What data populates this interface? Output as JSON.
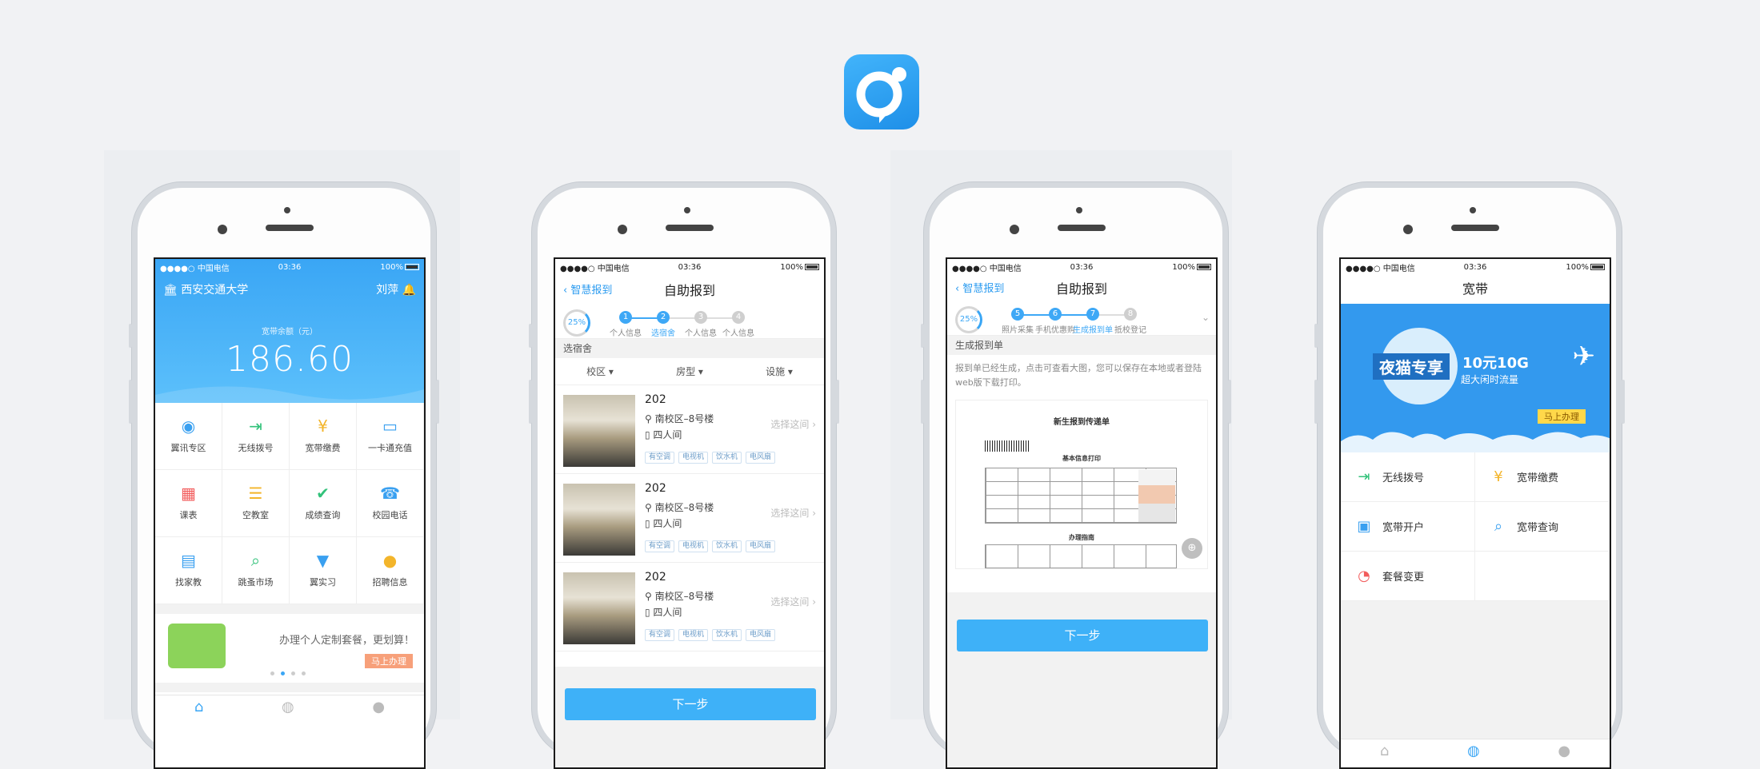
{
  "colors": {
    "accent": "#3ea8f6",
    "button": "#3eb1f8",
    "banner": "#3399ee",
    "orange": "#f7a07a",
    "yellow": "#ffd84a"
  },
  "statusbar": {
    "carrier": "●●●●○ 中国电信",
    "time": "03:36",
    "battery": "100%"
  },
  "screen1": {
    "school": "西安交通大学",
    "user": "刘萍",
    "balance_label": "宽带余额（元）",
    "balance": "186.60",
    "grid": [
      {
        "label": "翼讯专区",
        "icon": "swirl-icon",
        "color": "#3aa0f0"
      },
      {
        "label": "无线拨号",
        "icon": "dial-in-icon",
        "color": "#32c27a"
      },
      {
        "label": "宽带缴费",
        "icon": "yen-monitor-icon",
        "color": "#f3b52b"
      },
      {
        "label": "一卡通充值",
        "icon": "card-icon",
        "color": "#3aa0f0"
      },
      {
        "label": "课表",
        "icon": "calendar-icon",
        "color": "#f25c5c"
      },
      {
        "label": "空教室",
        "icon": "desk-icon",
        "color": "#f3b52b"
      },
      {
        "label": "成绩查询",
        "icon": "clipboard-icon",
        "color": "#32c27a"
      },
      {
        "label": "校园电话",
        "icon": "phone-icon",
        "color": "#3aa0f0"
      },
      {
        "label": "找家教",
        "icon": "book-icon",
        "color": "#3aa0f0"
      },
      {
        "label": "跳蚤市场",
        "icon": "bag-icon",
        "color": "#32c27a"
      },
      {
        "label": "翼实习",
        "icon": "tie-icon",
        "color": "#3aa0f0"
      },
      {
        "label": "招聘信息",
        "icon": "person-icon",
        "color": "#f3b52b"
      }
    ],
    "promo_text": "办理个人定制套餐，更划算！",
    "promo_button": "马上办理"
  },
  "screen2": {
    "back": "智慧报到",
    "title": "自助报到",
    "progress": "25%",
    "steps": [
      {
        "n": "1",
        "label": "个人信息",
        "state": "done"
      },
      {
        "n": "2",
        "label": "选宿舍",
        "state": "current"
      },
      {
        "n": "3",
        "label": "个人信息",
        "state": "off"
      },
      {
        "n": "4",
        "label": "个人信息",
        "state": "off"
      }
    ],
    "section": "选宿舍",
    "filters": [
      "校区 ▾",
      "房型 ▾",
      "设施 ▾"
    ],
    "rooms": [
      {
        "no": "202",
        "addr": "南校区–8号楼",
        "type": "四人间",
        "pick": "选择这间 ›",
        "tags": [
          "有空调",
          "电视机",
          "饮水机",
          "电风扇"
        ]
      },
      {
        "no": "202",
        "addr": "南校区–8号楼",
        "type": "四人间",
        "pick": "选择这间 ›",
        "tags": [
          "有空调",
          "电视机",
          "饮水机",
          "电风扇"
        ]
      },
      {
        "no": "202",
        "addr": "南校区–8号楼",
        "type": "四人间",
        "pick": "选择这间 ›",
        "tags": [
          "有空调",
          "电视机",
          "饮水机",
          "电风扇"
        ]
      }
    ],
    "next": "下一步"
  },
  "screen3": {
    "back": "智慧报到",
    "title": "自助报到",
    "progress": "25%",
    "steps": [
      {
        "n": "5",
        "label": "照片采集",
        "state": "done"
      },
      {
        "n": "6",
        "label": "手机优惠购",
        "state": "done"
      },
      {
        "n": "7",
        "label": "生成报到单",
        "state": "current"
      },
      {
        "n": "8",
        "label": "抵校登记",
        "state": "off"
      }
    ],
    "section": "生成报到单",
    "desc": "报到单已经生成，点击可查看大图，您可以保存在本地或者登陆web版下载打印。",
    "doc_title": "新生报到传递单",
    "doc_sub1": "基本信息打印",
    "doc_sub2": "办理指南",
    "next": "下一步"
  },
  "screen4": {
    "title": "宽带",
    "banner_title": "夜猫专享",
    "banner_offer": "10元10G",
    "banner_sub": "超大闲时流量",
    "banner_button": "马上办理",
    "services": [
      {
        "label": "无线拨号",
        "icon": "dial-in-icon",
        "color": "#32c27a"
      },
      {
        "label": "宽带缴费",
        "icon": "yen-monitor-icon",
        "color": "#f3b52b"
      },
      {
        "label": "宽带开户",
        "icon": "id-card-icon",
        "color": "#3aa0f0"
      },
      {
        "label": "宽带查询",
        "icon": "search-icon",
        "color": "#3aa0f0"
      },
      {
        "label": "套餐变更",
        "icon": "pie-icon",
        "color": "#f25c5c"
      },
      {
        "label": "",
        "icon": "",
        "color": ""
      }
    ]
  }
}
